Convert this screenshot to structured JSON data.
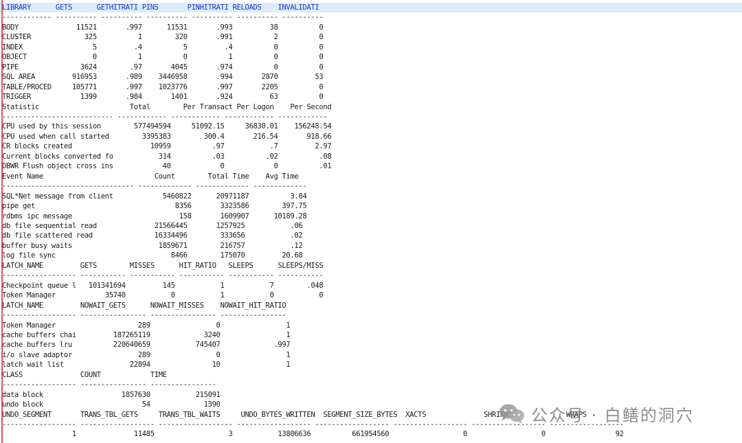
{
  "report": {
    "header_line": "LIBRARY      GETS      GETHITRATI PINS       PINHITRATI RELOADS    INVALIDATI",
    "lines": [
      "------------ ---------- ---------- ---------- ---------- ---------- ----------",
      "BODY              11521       .997      11531       .993         38          0",
      "CLUSTER             325          1        320       .991          2          0",
      "INDEX                 5         .4          5         .4          0          0",
      "OBJECT                0          1          0          1          0          0",
      "PIPE               3624        .97       4045       .974          0          0",
      "SQL AREA         916953       .989    3446958       .994       2870         53",
      "TABLE/PROCED     105771       .997    1023776       .997       2205          0",
      "TRIGGER            1399       .984       1401       .924         63          0",
      "Statistic                      Total        Per Transact Per Logon    Per Second",
      "--------------------------- ------------ ------------ ------------ ------------",
      "CPU used by this session        577494594     51092.15     36830.01    156248.54",
      "CPU used when call started        3395383        300.4       216.54       918.66",
      "CR blocks created                   10959          .97           .7         2.97",
      "Current blocks converted fo           314          .03          .02          .08",
      "DBWR Flush object cross ins            40            0            0          .01",
      "Event Name                           Count        Total Time    Avg Time",
      "-------------------------------- ------------- ------------- -------------",
      "SQL*Net message from client            5460822      20971187          3.84",
      "pipe get                                  8356       3323586        397.75",
      "rdbms ipc message                          158       1609907      10189.28",
      "db file sequential read              21566445       1257925           .06",
      "db file scattered read               16334496        333656           .02",
      "buffer busy waits                     1859671        216757           .12",
      "log file sync                            8466        175070         20.68",
      "LATCH_NAME         GETS        MISSES      HIT_RATIO   SLEEPS      SLEEPS/MISS",
      "------------------ ----------- ----------- ----------- ----------- -----------",
      "Checkpoint queue l   101341694         145           1           7        .048",
      "Token Manager            35740           0           1           0           0",
      "LATCH_NAME         NOWAIT_GETS      NOWAIT_MISSES    NOWAIT_HIT_RATIO",
      "------------------ ---------------- ---------------- ----------------",
      "Token Manager                    289                0                1",
      "cache buffers chai         187265119             3240                1",
      "cache buffers lru          220640659           745407             .997",
      "i/o slave adaptor                289                0                1",
      "latch wait list                22894               10                1",
      "CLASS              COUNT            TIME",
      "------------------ ---------------- ----------------",
      "data block                   1857630           215091",
      "undo block                        54             1390",
      "UNDO_SEGMENT       TRANS_TBL_GETS     TRANS_TBL_WAITS     UNDO_BYTES_WRITTEN  SEGMENT_SIZE_BYTES  XACTS              SHRINKS             WRAPS",
      "------------------ ------------------ ------------------ ------------------ ------------------ ------------------ ------------------ ------------------",
      "                 1              11485                  3           13806636          661954560                  0                  0                 92"
    ]
  },
  "watermark": {
    "text": "公众号 · 白鳝的洞穴",
    "icon": "wechat-icon"
  },
  "colors": {
    "header_text": "#1733d6",
    "header_background": "#dcecfb",
    "body_text": "#1a1a1a",
    "caret": "#e05555"
  }
}
